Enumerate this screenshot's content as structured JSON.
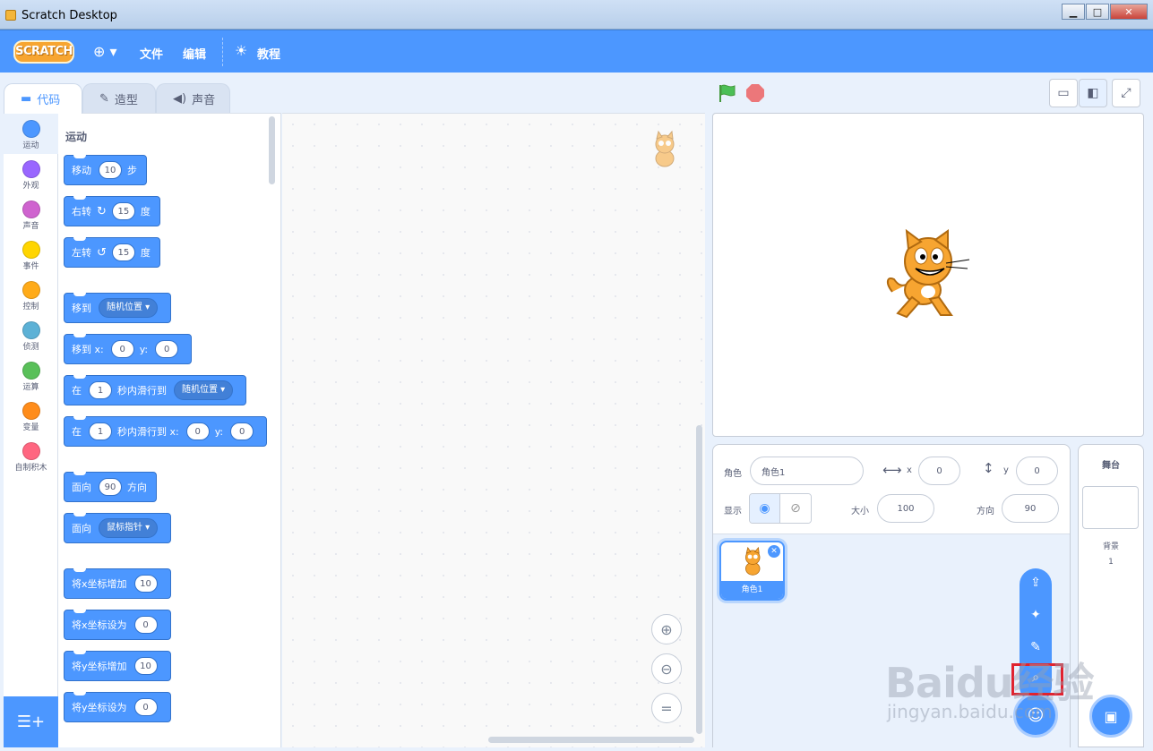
{
  "window": {
    "title": "Scratch Desktop",
    "min": "▁",
    "max": "□",
    "close": "✕"
  },
  "menubar": {
    "logo": "SCRATCH",
    "file": "文件",
    "edit": "编辑",
    "tutorials": "教程"
  },
  "tabs": [
    {
      "label": "代码"
    },
    {
      "label": "造型"
    },
    {
      "label": "声音"
    }
  ],
  "categories": [
    {
      "label": "运动",
      "color": "#4c97ff"
    },
    {
      "label": "外观",
      "color": "#9966ff"
    },
    {
      "label": "声音",
      "color": "#cf63cf"
    },
    {
      "label": "事件",
      "color": "#ffd500"
    },
    {
      "label": "控制",
      "color": "#ffab19"
    },
    {
      "label": "侦测",
      "color": "#5cb1d6"
    },
    {
      "label": "运算",
      "color": "#59c059"
    },
    {
      "label": "变量",
      "color": "#ff8c1a"
    },
    {
      "label": "自制积木",
      "color": "#ff6680"
    }
  ],
  "palette": {
    "section": "运动",
    "b1": {
      "a": "移动",
      "v": "10",
      "b": "步"
    },
    "b2": {
      "a": "右转",
      "v": "15",
      "b": "度"
    },
    "b3": {
      "a": "左转",
      "v": "15",
      "b": "度"
    },
    "b4": {
      "a": "移到",
      "d": "随机位置"
    },
    "b5": {
      "a": "移到 x:",
      "v": "0",
      "b": "y:",
      "v2": "0"
    },
    "b6": {
      "a": "在",
      "v": "1",
      "b": "秒内滑行到",
      "d": "随机位置"
    },
    "b7": {
      "a": "在",
      "v": "1",
      "b": "秒内滑行到 x:",
      "v2": "0",
      "c": "y:",
      "v3": "0"
    },
    "b8": {
      "a": "面向",
      "v": "90",
      "b": "方向"
    },
    "b9": {
      "a": "面向",
      "d": "鼠标指针"
    },
    "b10": {
      "a": "将x坐标增加",
      "v": "10"
    },
    "b11": {
      "a": "将x坐标设为",
      "v": "0"
    },
    "b12": {
      "a": "将y坐标增加",
      "v": "10"
    },
    "b13": {
      "a": "将y坐标设为",
      "v": "0"
    }
  },
  "sprite_info": {
    "sprite_label": "角色",
    "sprite_name": "角色1",
    "x_label": "x",
    "x_value": "0",
    "y_label": "y",
    "y_value": "0",
    "show_label": "显示",
    "size_label": "大小",
    "size_value": "100",
    "direction_label": "方向",
    "direction_value": "90"
  },
  "sprites": [
    {
      "name": "角色1"
    }
  ],
  "stage_target": {
    "title": "舞台",
    "backdrops_label": "背景",
    "backdrops_count": "1"
  },
  "watermark": {
    "main": "Baidu经验",
    "sub": "jingyan.baidu.com"
  }
}
